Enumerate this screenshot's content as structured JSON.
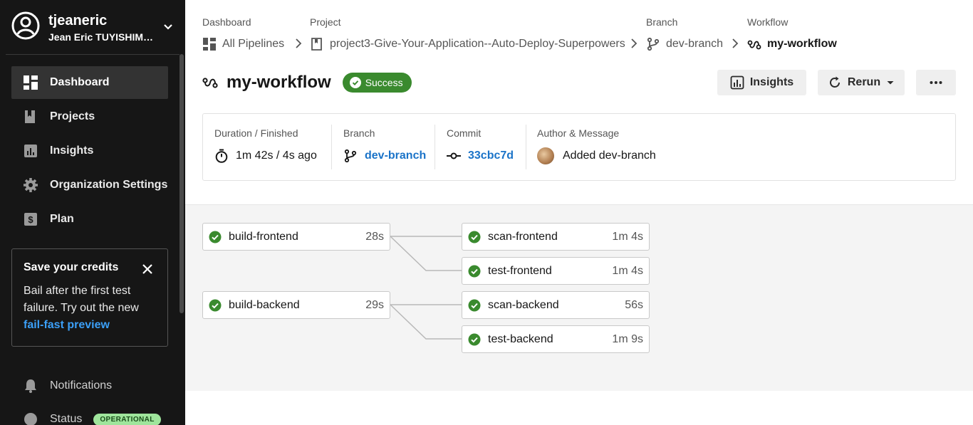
{
  "user": {
    "username": "tjeaneric",
    "full_name": "Jean Eric TUYISHIMI..."
  },
  "nav": {
    "dashboard": "Dashboard",
    "projects": "Projects",
    "insights": "Insights",
    "org_settings": "Organization Settings",
    "plan": "Plan"
  },
  "credits": {
    "title": "Save your credits",
    "body": "Bail after the first test failure. Try out the new",
    "link": "fail-fast preview"
  },
  "bottom_nav": {
    "notifications": "Notifications",
    "status": "Status",
    "status_badge": "OPERATIONAL"
  },
  "breadcrumb": {
    "dashboard_label": "Dashboard",
    "dashboard_value": "All Pipelines",
    "project_label": "Project",
    "project_value": "project3-Give-Your-Application--Auto-Deploy-Superpowers",
    "branch_label": "Branch",
    "branch_value": "dev-branch",
    "workflow_label": "Workflow",
    "workflow_value": "my-workflow"
  },
  "header": {
    "title": "my-workflow",
    "status": "Success",
    "insights_button": "Insights",
    "rerun_button": "Rerun"
  },
  "info": {
    "duration_label": "Duration / Finished",
    "duration_value": "1m 42s / 4s ago",
    "branch_label": "Branch",
    "branch_value": "dev-branch",
    "commit_label": "Commit",
    "commit_value": "33cbc7d",
    "author_label": "Author & Message",
    "message": "Added dev-branch"
  },
  "jobs": [
    {
      "name": "build-frontend",
      "duration": "28s",
      "status": "success"
    },
    {
      "name": "scan-frontend",
      "duration": "1m 4s",
      "status": "success"
    },
    {
      "name": "test-frontend",
      "duration": "1m 4s",
      "status": "success"
    },
    {
      "name": "build-backend",
      "duration": "29s",
      "status": "success"
    },
    {
      "name": "scan-backend",
      "duration": "56s",
      "status": "success"
    },
    {
      "name": "test-backend",
      "duration": "1m 9s",
      "status": "success"
    }
  ],
  "colors": {
    "sidebar_bg": "#161616",
    "success": "#3a8a2e",
    "link": "#1a73c8",
    "accent_link": "#3b9ff7",
    "operational_badge": "#9fe59c"
  }
}
